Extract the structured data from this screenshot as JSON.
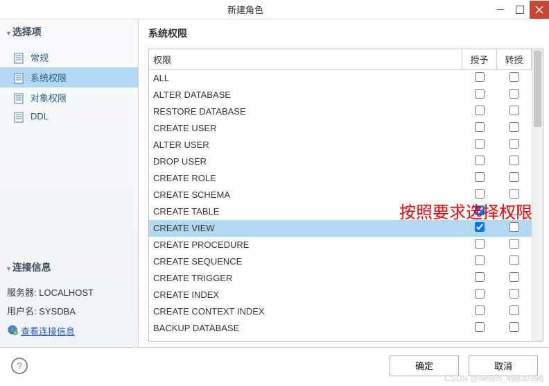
{
  "window": {
    "title": "新建角色"
  },
  "sidebar": {
    "section1_title": "选择项",
    "items": [
      {
        "label": "常规"
      },
      {
        "label": "系统权限"
      },
      {
        "label": "对象权限"
      },
      {
        "label": "DDL"
      }
    ],
    "selected_index": 1,
    "section2_title": "连接信息",
    "server_label": "服务器:",
    "server_value": "LOCALHOST",
    "user_label": "用户名:",
    "user_value": "SYSDBA",
    "view_conn_link": "查看连接信息"
  },
  "content": {
    "title": "系统权限",
    "columns": {
      "permission": "权限",
      "grant": "授予",
      "transfer": "转授"
    },
    "rows": [
      {
        "name": "ALL",
        "grant": false,
        "transfer": false
      },
      {
        "name": "ALTER DATABASE",
        "grant": false,
        "transfer": false
      },
      {
        "name": "RESTORE DATABASE",
        "grant": false,
        "transfer": false
      },
      {
        "name": "CREATE USER",
        "grant": false,
        "transfer": false
      },
      {
        "name": "ALTER USER",
        "grant": false,
        "transfer": false
      },
      {
        "name": "DROP USER",
        "grant": false,
        "transfer": false
      },
      {
        "name": "CREATE ROLE",
        "grant": false,
        "transfer": false
      },
      {
        "name": "CREATE SCHEMA",
        "grant": false,
        "transfer": false
      },
      {
        "name": "CREATE TABLE",
        "grant": true,
        "transfer": false
      },
      {
        "name": "CREATE VIEW",
        "grant": true,
        "transfer": false
      },
      {
        "name": "CREATE PROCEDURE",
        "grant": false,
        "transfer": false
      },
      {
        "name": "CREATE SEQUENCE",
        "grant": false,
        "transfer": false
      },
      {
        "name": "CREATE TRIGGER",
        "grant": false,
        "transfer": false
      },
      {
        "name": "CREATE INDEX",
        "grant": false,
        "transfer": false
      },
      {
        "name": "CREATE CONTEXT INDEX",
        "grant": false,
        "transfer": false
      },
      {
        "name": "BACKUP DATABASE",
        "grant": false,
        "transfer": false
      }
    ],
    "selected_row": 9
  },
  "annotation": "按照要求选择权限",
  "footer": {
    "help": "?",
    "ok": "确定",
    "cancel": "取消"
  },
  "watermark": "CSDN @weixin_49830398"
}
